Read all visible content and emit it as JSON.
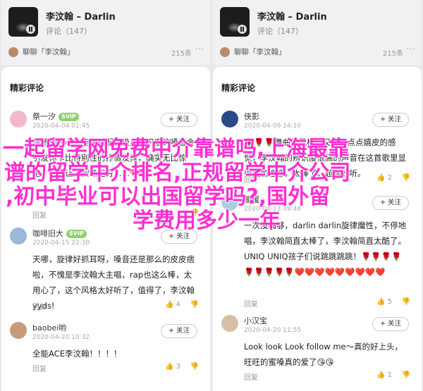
{
  "left": {
    "player": {
      "song": "李汶翰 – Darlin",
      "reviews": "评论（147）",
      "chat": "聊聊「李汶翰」",
      "count": "215条",
      "more": "···"
    },
    "panel_title": "精彩评论",
    "comments": [
      {
        "user": "祭一汐",
        "vip": "SVIP",
        "time": "2020-04-04 01:45",
        "follow": "+ 关注",
        "text": "你扬动人心的旋律再配合极具辨识度的嗓音会引发你卡比特别性的抒情发挥，确实无比惊艳，一曲让人回味无穷……❤️❤️",
        "reply": "回复",
        "likes": "1",
        "avatar_color": "#f0b8c8"
      },
      {
        "user": "咖啡旧大",
        "vip": "SVIP",
        "time": "2020-04-15 22:30",
        "follow": "+ 关注",
        "text": "天哪，旋律好抓耳呀，嗓音还是那么的皮皮痞啦，不愧是李汶翰大主唱，rap也这么棒，太用心了，这个风格太好听了，值得了，李汶翰yyds!",
        "reply": "回复",
        "likes": "4",
        "avatar_color": "#9cb7d8"
      },
      {
        "user": "baobei哟",
        "vip": "",
        "time": "2020-04-20 10:32",
        "follow": "+ 关注",
        "text": "全能ACE李汶翰！！！！",
        "reply": "回复",
        "likes": "3",
        "avatar_color": "#c99a7a"
      }
    ]
  },
  "right": {
    "player": {
      "song": "李汶翰 – Darlin",
      "reviews": "评论（147）",
      "chat": "聊聊「李汶翰」",
      "count": "215条",
      "more": "···"
    },
    "panel_title": "精彩评论",
    "comments": [
      {
        "user": "侠影",
        "vip": "",
        "time": "2020-04-09 14:10",
        "follow": "+ 关注",
        "text": "🌹🌹🌹舞曲的风格，又有一点点嬉皮的感觉，李汶翰的辨识度很高的声音在这首歌里显得更加性感，太棒了，超级好听。",
        "reply": "回复",
        "likes": "2",
        "avatar_color": "#2a4a8a"
      },
      {
        "user": "暖暖",
        "vip": "",
        "time": "2020-04-13 09:48",
        "follow": "+ 关注",
        "text": "一次没嗨够，darlin darlin旋律魔性，不停地唱，李汶翰简直太棒了，李汶翰简直太酷了。UNIQ UNIQ孩子们说跳跳跳跳！🌹🌹🌹🌹🌹🌹🌹🌹🌹❤️❤️❤️❤️❤️❤️❤️❤️❤️",
        "reply": "回复",
        "likes": "5",
        "avatar_color": "#a9cde6"
      },
      {
        "user": "小汉宝",
        "vip": "",
        "time": "2020-04-20 11:55",
        "follow": "+ 关注",
        "text": "Look look Look follow me～真的好上头，旺旺的蜜嗓真的爱了😘😘",
        "reply": "回复",
        "likes": "1",
        "avatar_color": "#d7bfa6"
      }
    ]
  },
  "overlay": {
    "line1": "一起留学网免费中介靠谱吗,上海最靠",
    "line2": "谱的留学中介排名,正规留学中介公司",
    "line3": ",初中毕业可以出国留学吗?,国外留",
    "line4": "学费用多少一年"
  }
}
